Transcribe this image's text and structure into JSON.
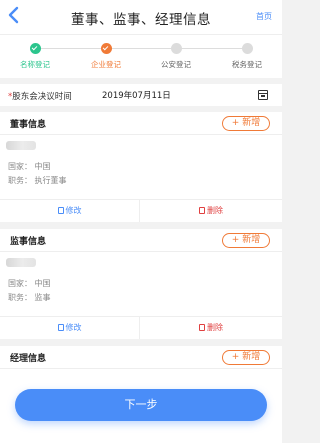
{
  "header": {
    "title": "董事、监事、经理信息",
    "home": "首页",
    "back_icon": "chevron-left-icon"
  },
  "steps": [
    {
      "label": "名称登记",
      "status": "done"
    },
    {
      "label": "企业登记",
      "status": "active"
    },
    {
      "label": "公安登记",
      "status": "todo"
    },
    {
      "label": "税务登记",
      "status": "todo"
    }
  ],
  "colors": {
    "accent": "#4a8df8",
    "done": "#2bc58d",
    "active": "#f07a37",
    "danger": "#e04040"
  },
  "resolution": {
    "required_mark": "*",
    "label": "股东会决议时间",
    "value": "2019年07月11日",
    "icon": "calendar-icon"
  },
  "directors": {
    "title": "董事信息",
    "add_label": "+ 新增",
    "country": "国家：  中国",
    "position": "职务：  执行董事",
    "edit_label": "修改",
    "delete_label": "删除"
  },
  "supervisors": {
    "title": "监事信息",
    "add_label": "+ 新增",
    "country": "国家：  中国",
    "position": "职务：  监事",
    "edit_label": "修改",
    "delete_label": "删除"
  },
  "managers": {
    "title": "经理信息",
    "add_label": "+ 新增"
  },
  "next_button": "下一步"
}
